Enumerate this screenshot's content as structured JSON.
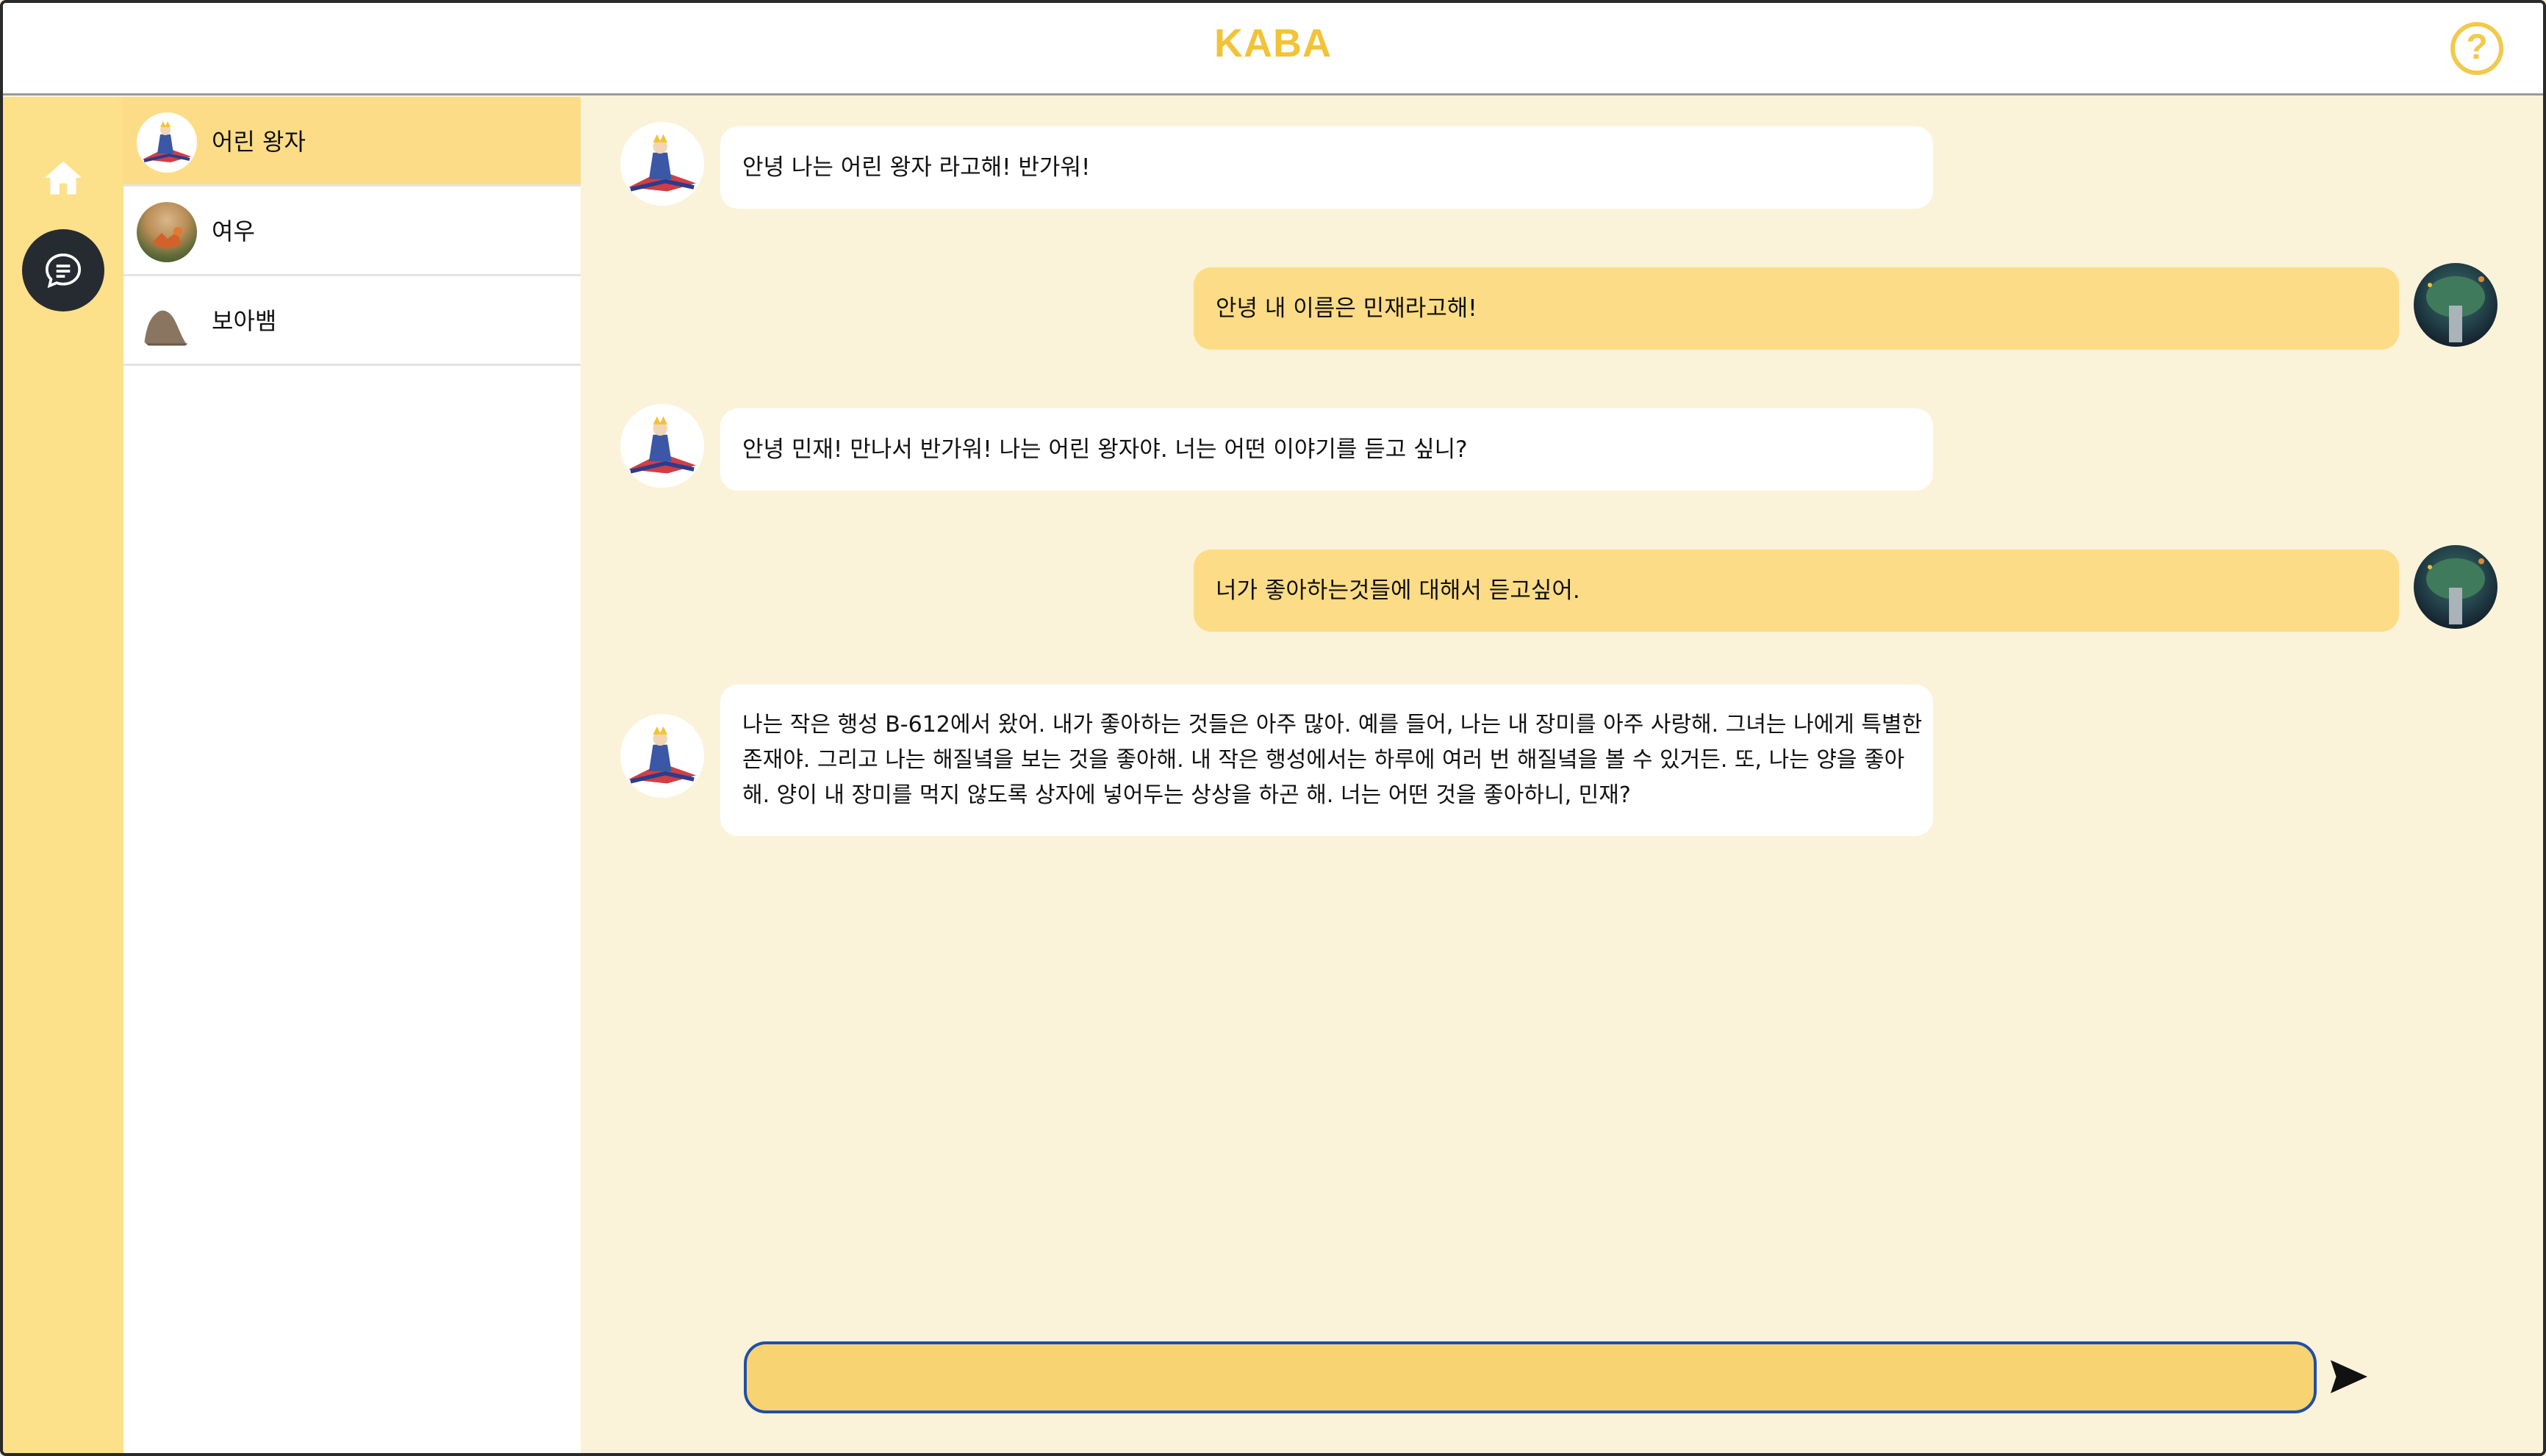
{
  "header": {
    "title": "KABA",
    "help_icon": "help-circle-icon"
  },
  "nav_rail": {
    "items": [
      {
        "icon": "home-icon"
      },
      {
        "icon": "chat-bubble-icon",
        "active": true
      }
    ]
  },
  "characters": [
    {
      "name": "어린 왕자",
      "avatar": "little-prince-avatar",
      "active": true
    },
    {
      "name": "여우",
      "avatar": "fox-avatar",
      "active": false
    },
    {
      "name": "보아뱀",
      "avatar": "boa-avatar",
      "active": false
    }
  ],
  "messages": [
    {
      "from": "bot",
      "text": "안녕 나는 어린 왕자 라고해! 반가워!"
    },
    {
      "from": "user",
      "text": "안녕 내 이름은 민재라고해!"
    },
    {
      "from": "bot",
      "text": "안녕 민재! 만나서 반가워! 나는 어린 왕자야. 너는 어떤 이야기를 듣고 싶니?"
    },
    {
      "from": "user",
      "text": "너가 좋아하는것들에 대해서 듣고싶어."
    },
    {
      "from": "bot",
      "lines": [
        "나는 작은 행성 B-612에서 왔어. 내가 좋아하는 것들은 아주 많아. 예를 들어, 나는 내 장미를 아주 사랑해. 그녀는 나에게 특별한",
        "존재야. 그리고 나는 해질녘을 보는 것을 좋아해. 내 작은 행성에서는 하루에 여러 번 해질녘을 볼 수 있거든. 또, 나는 양을 좋아",
        "해. 양이 내 장미를 먹지 않도록 상자에 넣어두는 상상을 하곤 해. 너는 어떤 것을 좋아하니, 민재?"
      ]
    }
  ],
  "composer": {
    "value": "",
    "placeholder": "",
    "send_icon": "send-icon"
  },
  "colors": {
    "accent": "#f2c337",
    "sidebar": "#fce08a",
    "chat_bg": "#fbf3d9",
    "user_bubble": "#fcdc86",
    "input": "#f8d372",
    "input_border": "#1f4fa8"
  }
}
